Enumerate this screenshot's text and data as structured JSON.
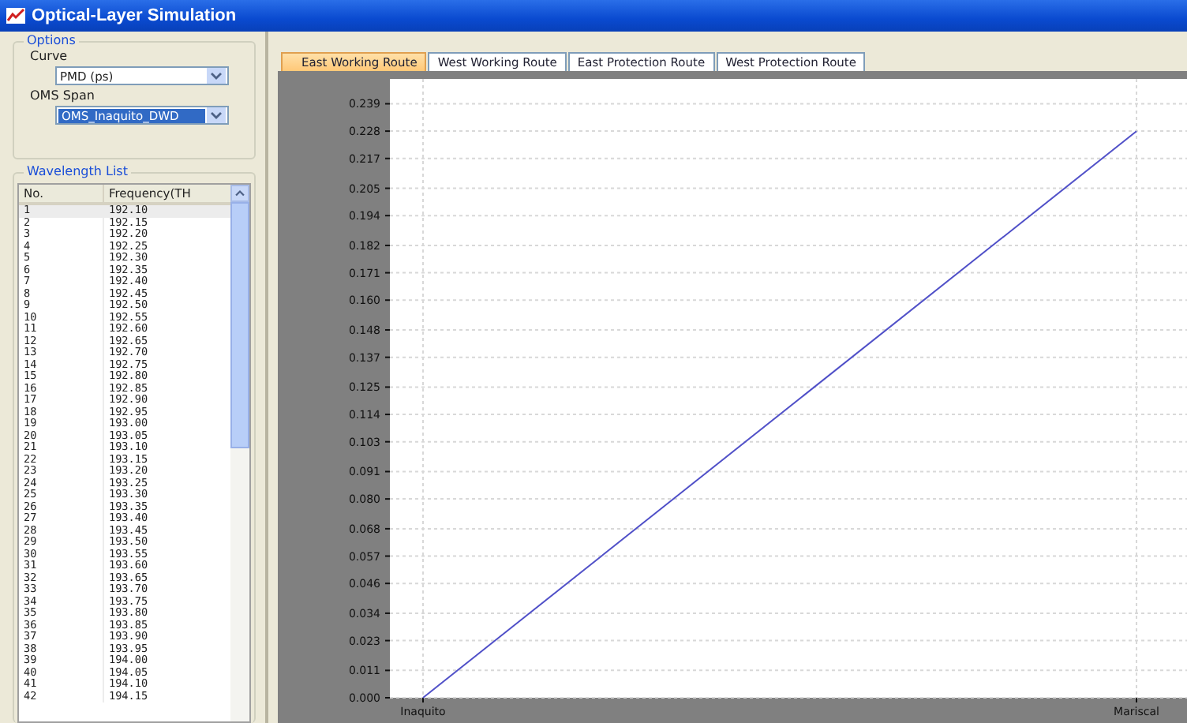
{
  "window": {
    "title": "Optical-Layer Simulation"
  },
  "options": {
    "title": "Options",
    "curve_label": "Curve",
    "curve_value": "PMD (ps)",
    "span_label": "OMS Span",
    "span_value": "OMS_Inaquito_DWD"
  },
  "wavelength_list": {
    "title": "Wavelength List",
    "columns": [
      "No.",
      "Frequency(TH"
    ],
    "rows": [
      {
        "no": "1",
        "freq": "192.10",
        "selected": true
      },
      {
        "no": "2",
        "freq": "192.15",
        "selected": false
      },
      {
        "no": "3",
        "freq": "192.20",
        "selected": false
      },
      {
        "no": "4",
        "freq": "192.25",
        "selected": false
      },
      {
        "no": "5",
        "freq": "192.30",
        "selected": false
      },
      {
        "no": "6",
        "freq": "192.35",
        "selected": false
      },
      {
        "no": "7",
        "freq": "192.40",
        "selected": false
      },
      {
        "no": "8",
        "freq": "192.45",
        "selected": false
      },
      {
        "no": "9",
        "freq": "192.50",
        "selected": false
      },
      {
        "no": "10",
        "freq": "192.55",
        "selected": false
      },
      {
        "no": "11",
        "freq": "192.60",
        "selected": false
      },
      {
        "no": "12",
        "freq": "192.65",
        "selected": false
      },
      {
        "no": "13",
        "freq": "192.70",
        "selected": false
      },
      {
        "no": "14",
        "freq": "192.75",
        "selected": false
      },
      {
        "no": "15",
        "freq": "192.80",
        "selected": false
      },
      {
        "no": "16",
        "freq": "192.85",
        "selected": false
      },
      {
        "no": "17",
        "freq": "192.90",
        "selected": false
      },
      {
        "no": "18",
        "freq": "192.95",
        "selected": false
      },
      {
        "no": "19",
        "freq": "193.00",
        "selected": false
      },
      {
        "no": "20",
        "freq": "193.05",
        "selected": false
      },
      {
        "no": "21",
        "freq": "193.10",
        "selected": false
      },
      {
        "no": "22",
        "freq": "193.15",
        "selected": false
      },
      {
        "no": "23",
        "freq": "193.20",
        "selected": false
      },
      {
        "no": "24",
        "freq": "193.25",
        "selected": false
      },
      {
        "no": "25",
        "freq": "193.30",
        "selected": false
      },
      {
        "no": "26",
        "freq": "193.35",
        "selected": false
      },
      {
        "no": "27",
        "freq": "193.40",
        "selected": false
      },
      {
        "no": "28",
        "freq": "193.45",
        "selected": false
      },
      {
        "no": "29",
        "freq": "193.50",
        "selected": false
      },
      {
        "no": "30",
        "freq": "193.55",
        "selected": false
      },
      {
        "no": "31",
        "freq": "193.60",
        "selected": false
      },
      {
        "no": "32",
        "freq": "193.65",
        "selected": false
      },
      {
        "no": "33",
        "freq": "193.70",
        "selected": false
      },
      {
        "no": "34",
        "freq": "193.75",
        "selected": false
      },
      {
        "no": "35",
        "freq": "193.80",
        "selected": false
      },
      {
        "no": "36",
        "freq": "193.85",
        "selected": false
      },
      {
        "no": "37",
        "freq": "193.90",
        "selected": false
      },
      {
        "no": "38",
        "freq": "193.95",
        "selected": false
      },
      {
        "no": "39",
        "freq": "194.00",
        "selected": false
      },
      {
        "no": "40",
        "freq": "194.05",
        "selected": false
      },
      {
        "no": "41",
        "freq": "194.10",
        "selected": false
      },
      {
        "no": "42",
        "freq": "194.15",
        "selected": false
      }
    ]
  },
  "tabs": [
    {
      "label": "East Working Route",
      "selected": true
    },
    {
      "label": "West Working Route",
      "selected": false
    },
    {
      "label": "East Protection Route",
      "selected": false
    },
    {
      "label": "West Protection Route",
      "selected": false
    }
  ],
  "chart_data": {
    "type": "line",
    "categories": [
      "Inaquito",
      "Mariscal"
    ],
    "series": [
      {
        "color": "#5050c8",
        "values": [
          0,
          0.228
        ]
      }
    ],
    "ylim": [
      0,
      0.249
    ],
    "yticks": [
      0.239,
      0.228,
      0.217,
      0.205,
      0.194,
      0.182,
      0.171,
      {
        "value": 0.16,
        "label": "0.160"
      },
      0.148,
      0.137,
      0.125,
      0.114,
      0.103,
      0.091,
      {
        "value": 0.08,
        "label": "0.080"
      },
      0.068,
      0.057,
      0.046,
      0.034,
      0.023,
      0.011,
      {
        "value": 0,
        "label": "0.000"
      }
    ]
  }
}
